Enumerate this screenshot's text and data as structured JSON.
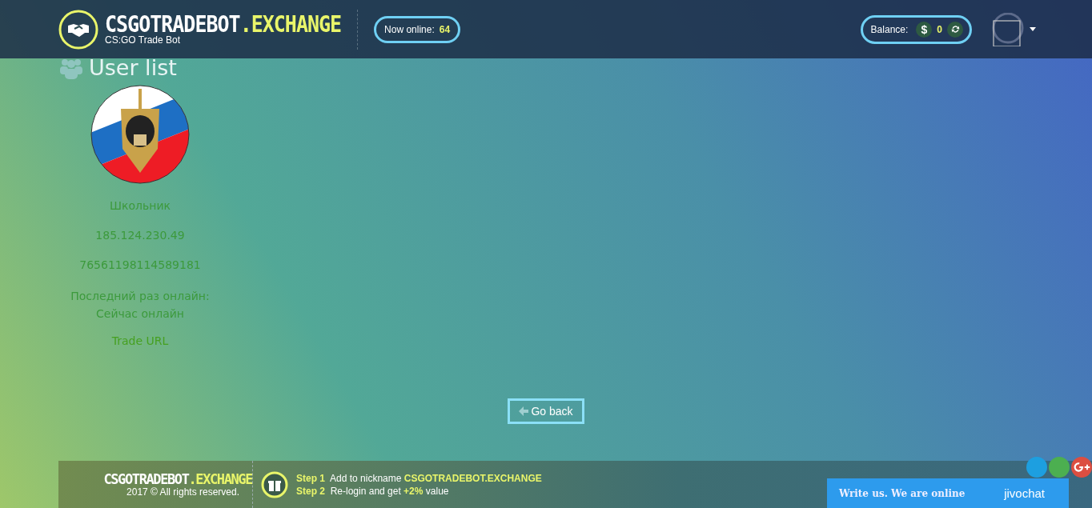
{
  "header": {
    "logo_main": "CSGOTRADEBOT",
    "logo_accent": ".EXCHANGE",
    "logo_sub": "CS:GO Trade Bot",
    "online_label": "Now online:",
    "online_count": "64",
    "balance_label": "Balance:",
    "balance_currency": "$",
    "balance_value": "0"
  },
  "page": {
    "title": "User list"
  },
  "user": {
    "name": "Школьник",
    "ip": "185.124.230.49",
    "steam_id": "76561198114589181",
    "last_online_label": "Последний раз онлайн:",
    "last_online_value": "Сейчас онлайн",
    "trade_url": "Trade URL"
  },
  "go_back": "Go back",
  "footer": {
    "logo_main": "CSGOTRADEBOT",
    "logo_accent": ".EXCHANGE",
    "copyright": "2017 © All rights reserved.",
    "steps": [
      {
        "label": "Step 1",
        "text": "Add to nickname **CSGOTRADEBOT.EXCHANGE**"
      },
      {
        "label": "Step 2",
        "text": "Re-login and get **+2%** value"
      }
    ]
  },
  "chat": {
    "text": "Write us. We are online",
    "brand": "jivochat"
  }
}
